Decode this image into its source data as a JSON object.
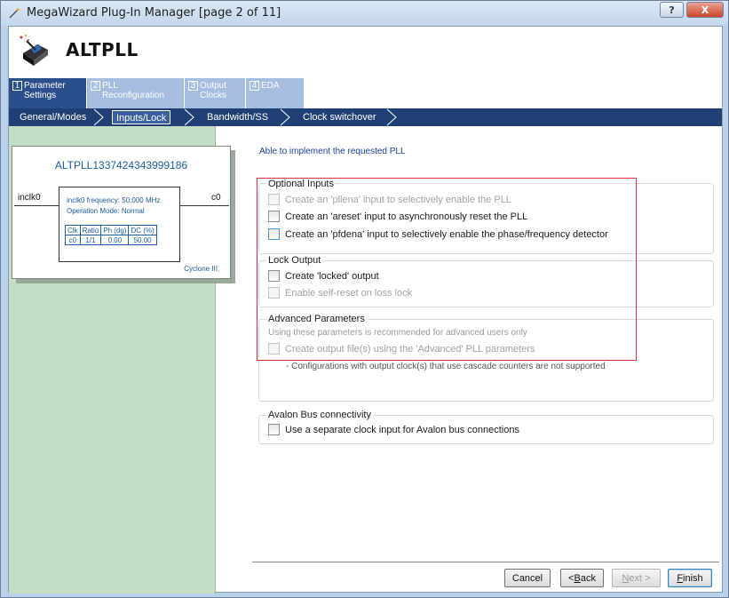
{
  "window": {
    "title": "MegaWizard Plug-In Manager [page 2 of 11]",
    "help_label": "?",
    "close_label": "X"
  },
  "header": {
    "title": "ALTPLL"
  },
  "tabs": [
    {
      "num": "1",
      "line1": "Parameter",
      "line2": "Settings"
    },
    {
      "num": "2",
      "line1": "PLL",
      "line2": "Reconfiguration"
    },
    {
      "num": "3",
      "line1": "Output",
      "line2": "Clocks"
    },
    {
      "num": "4",
      "line1": "EDA",
      "line2": ""
    }
  ],
  "subtabs": [
    "General/Modes",
    "Inputs/Lock",
    "Bandwidth/SS",
    "Clock switchover"
  ],
  "diagram": {
    "title": "ALTPLL1337424343999186",
    "input_pin": "inclk0",
    "output_pin": "c0",
    "freq": "inclk0 frequency: 50.000 MHz",
    "mode": "Operation Mode: Normal",
    "table_header": [
      "Clk",
      "Ratio",
      "Ph (dg)",
      "DC (%)"
    ],
    "table_row": [
      "c0",
      "1/1",
      "0.00",
      "50.00"
    ],
    "device": "Cyclone III"
  },
  "status_message": "Able to implement the requested PLL",
  "optional_inputs": {
    "title": "Optional Inputs",
    "items": [
      {
        "label": "Create an 'pllena' input to selectively enable the PLL",
        "enabled": false
      },
      {
        "label": "Create an 'areset' input to asynchronously reset the PLL",
        "enabled": true
      },
      {
        "label": "Create an 'pfdena' input to selectively enable the phase/frequency detector",
        "enabled": true
      }
    ]
  },
  "lock_output": {
    "title": "Lock Output",
    "items": [
      {
        "label": "Create 'locked' output",
        "enabled": true
      },
      {
        "label": "Enable self-reset on loss lock",
        "enabled": false
      }
    ]
  },
  "advanced": {
    "title": "Advanced Parameters",
    "note": "Using these parameters is recommended for advanced users only",
    "checkbox": "Create output file(s) using the 'Advanced' PLL parameters",
    "warning": "- Configurations with output clock(s) that use cascade counters are not supported"
  },
  "avalon": {
    "title": "Avalon Bus connectivity",
    "checkbox": "Use a separate clock input for Avalon bus connections"
  },
  "buttons": {
    "cancel": "Cancel",
    "back_pre": "< ",
    "back_u": "B",
    "back_post": "ack",
    "next_pre": "",
    "next_u": "N",
    "next_post": "ext >",
    "finish_pre": "",
    "finish_u": "F",
    "finish_post": "inish"
  }
}
